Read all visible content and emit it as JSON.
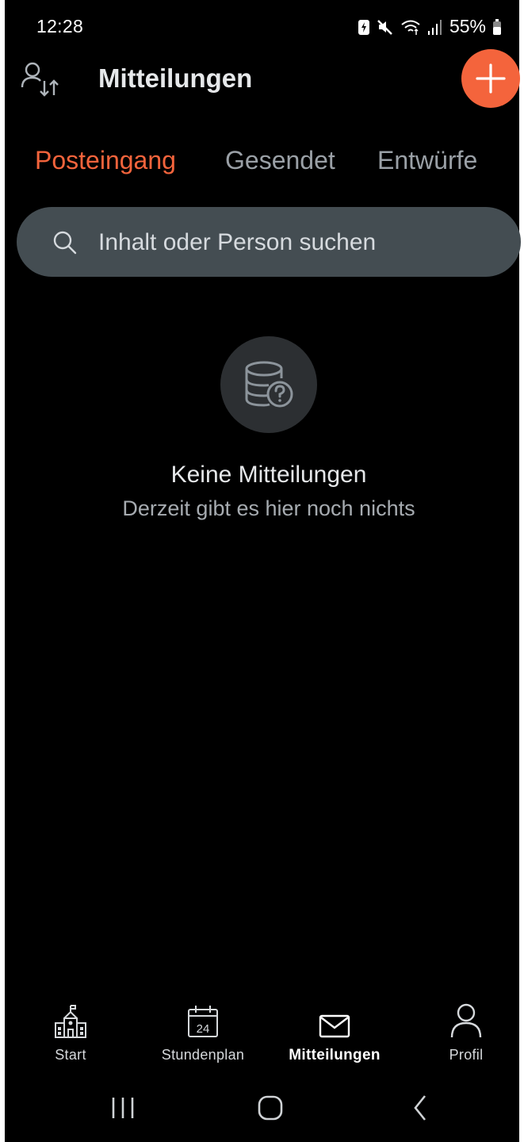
{
  "status_bar": {
    "time": "12:28",
    "battery": "55%",
    "icons": [
      "battery-saver-icon",
      "mute-icon",
      "wifi-icon",
      "signal-icon",
      "battery-icon"
    ]
  },
  "header": {
    "title": "Mitteilungen",
    "account_switch_icon": "account-switch-icon",
    "fab_icon": "plus-icon"
  },
  "tabs": [
    {
      "label": "Posteingang",
      "active": true
    },
    {
      "label": "Gesendet",
      "active": false
    },
    {
      "label": "Entwürfe",
      "active": false
    }
  ],
  "search": {
    "placeholder": "Inhalt oder Person suchen",
    "value": ""
  },
  "empty_state": {
    "icon": "database-question-icon",
    "title": "Keine Mitteilungen",
    "subtitle": "Derzeit gibt es hier noch nichts"
  },
  "bottom_nav": [
    {
      "label": "Start",
      "icon": "school-icon",
      "active": false
    },
    {
      "label": "Stundenplan",
      "icon": "calendar-icon",
      "calendar_day": "24",
      "active": false
    },
    {
      "label": "Mitteilungen",
      "icon": "mail-icon",
      "active": true
    },
    {
      "label": "Profil",
      "icon": "person-icon",
      "active": false
    }
  ],
  "system_nav": [
    "recents-icon",
    "home-icon",
    "back-icon"
  ],
  "colors": {
    "accent": "#f4643c",
    "background": "#000000",
    "search_bg": "#444d52",
    "inactive_tab": "#9aa0a6"
  }
}
